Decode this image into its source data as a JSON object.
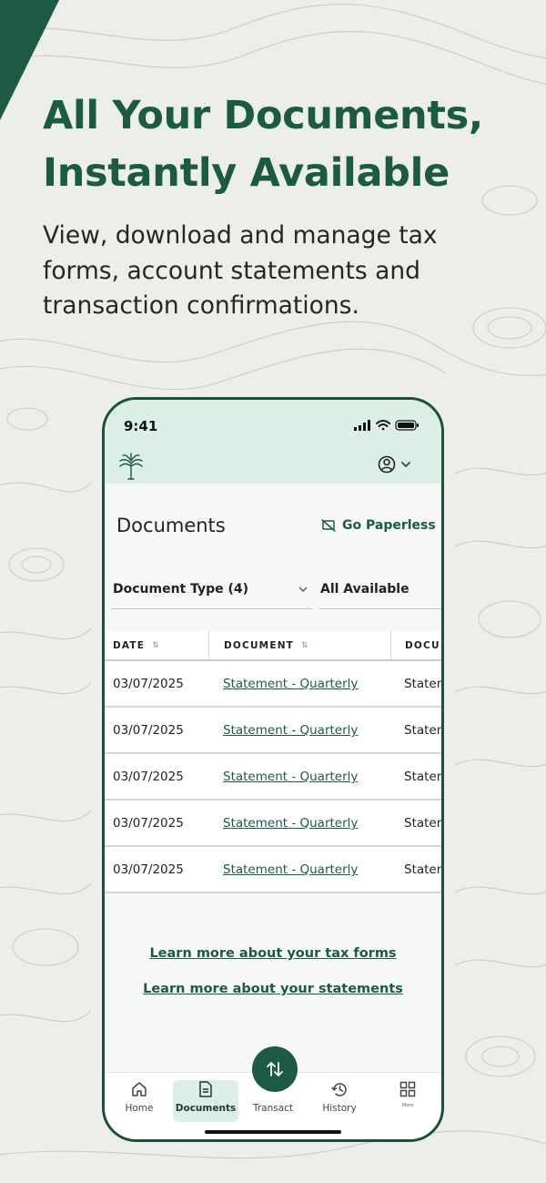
{
  "hero": {
    "headline_line1": "All Your Documents,",
    "headline_line2": "Instantly Available",
    "subtext": "View, download and manage tax forms, account statements and transaction confirmations."
  },
  "status_bar": {
    "time": "9:41"
  },
  "page": {
    "title": "Documents",
    "go_paperless_label": "Go Paperless"
  },
  "filters": {
    "document_type": "Document Type (4)",
    "availability": "All Available"
  },
  "table": {
    "columns": [
      "DATE",
      "DOCUMENT",
      "DOCU"
    ],
    "rows": [
      {
        "date": "03/07/2025",
        "document": "Statement - Quarterly",
        "type": "Statem"
      },
      {
        "date": "03/07/2025",
        "document": "Statement - Quarterly",
        "type": "Statem"
      },
      {
        "date": "03/07/2025",
        "document": "Statement - Quarterly",
        "type": "Statem"
      },
      {
        "date": "03/07/2025",
        "document": "Statement - Quarterly",
        "type": "Statem"
      },
      {
        "date": "03/07/2025",
        "document": "Statement - Quarterly",
        "type": "Statem"
      }
    ]
  },
  "links": {
    "tax_forms": "Learn more about your tax forms",
    "statements": "Learn more about your statements"
  },
  "tabbar": {
    "home": "Home",
    "documents": "Documents",
    "transact": "Transact",
    "history": "History",
    "more": "More"
  },
  "colors": {
    "brand_green": "#1c5a43",
    "header_mint": "#dcefe7",
    "background": "#eceee9"
  }
}
